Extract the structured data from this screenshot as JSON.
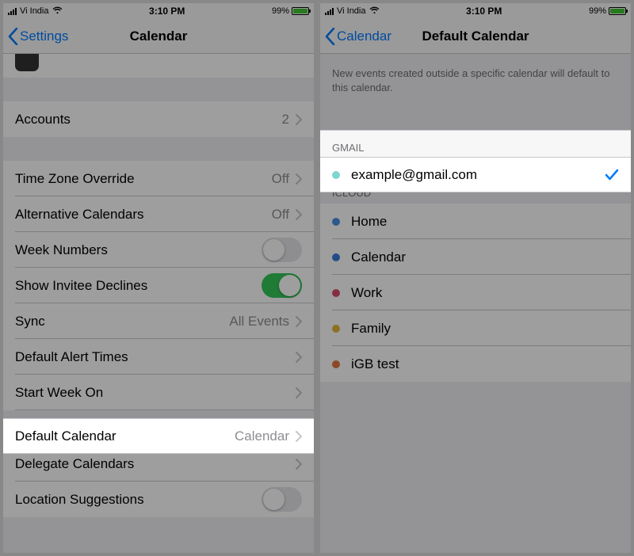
{
  "status": {
    "carrier": "Vi India",
    "time": "3:10 PM",
    "battery_pct": "99%"
  },
  "screen1": {
    "back_label": "Settings",
    "title": "Calendar",
    "rows": {
      "accounts": {
        "label": "Accounts",
        "value": "2"
      },
      "tz": {
        "label": "Time Zone Override",
        "value": "Off"
      },
      "alt": {
        "label": "Alternative Calendars",
        "value": "Off"
      },
      "week": {
        "label": "Week Numbers"
      },
      "invitee": {
        "label": "Show Invitee Declines"
      },
      "sync": {
        "label": "Sync",
        "value": "All Events"
      },
      "alerts": {
        "label": "Default Alert Times"
      },
      "start": {
        "label": "Start Week On"
      },
      "defcal": {
        "label": "Default Calendar",
        "value": "Calendar"
      },
      "delegate": {
        "label": "Delegate Calendars"
      },
      "locsugg": {
        "label": "Location Suggestions"
      }
    }
  },
  "screen2": {
    "back_label": "Calendar",
    "title": "Default Calendar",
    "description": "New events created outside a specific calendar will default to this calendar.",
    "sections": {
      "gmail_header": "GMAIL",
      "gmail_account": "example@gmail.com",
      "icloud_header": "ICLOUD",
      "icloud": [
        {
          "label": "Home",
          "color": "#4a90e2"
        },
        {
          "label": "Calendar",
          "color": "#3b7dd8"
        },
        {
          "label": "Work",
          "color": "#d94b6a"
        },
        {
          "label": "Family",
          "color": "#e2b93b"
        },
        {
          "label": "iGB test",
          "color": "#e0763a"
        }
      ]
    }
  }
}
